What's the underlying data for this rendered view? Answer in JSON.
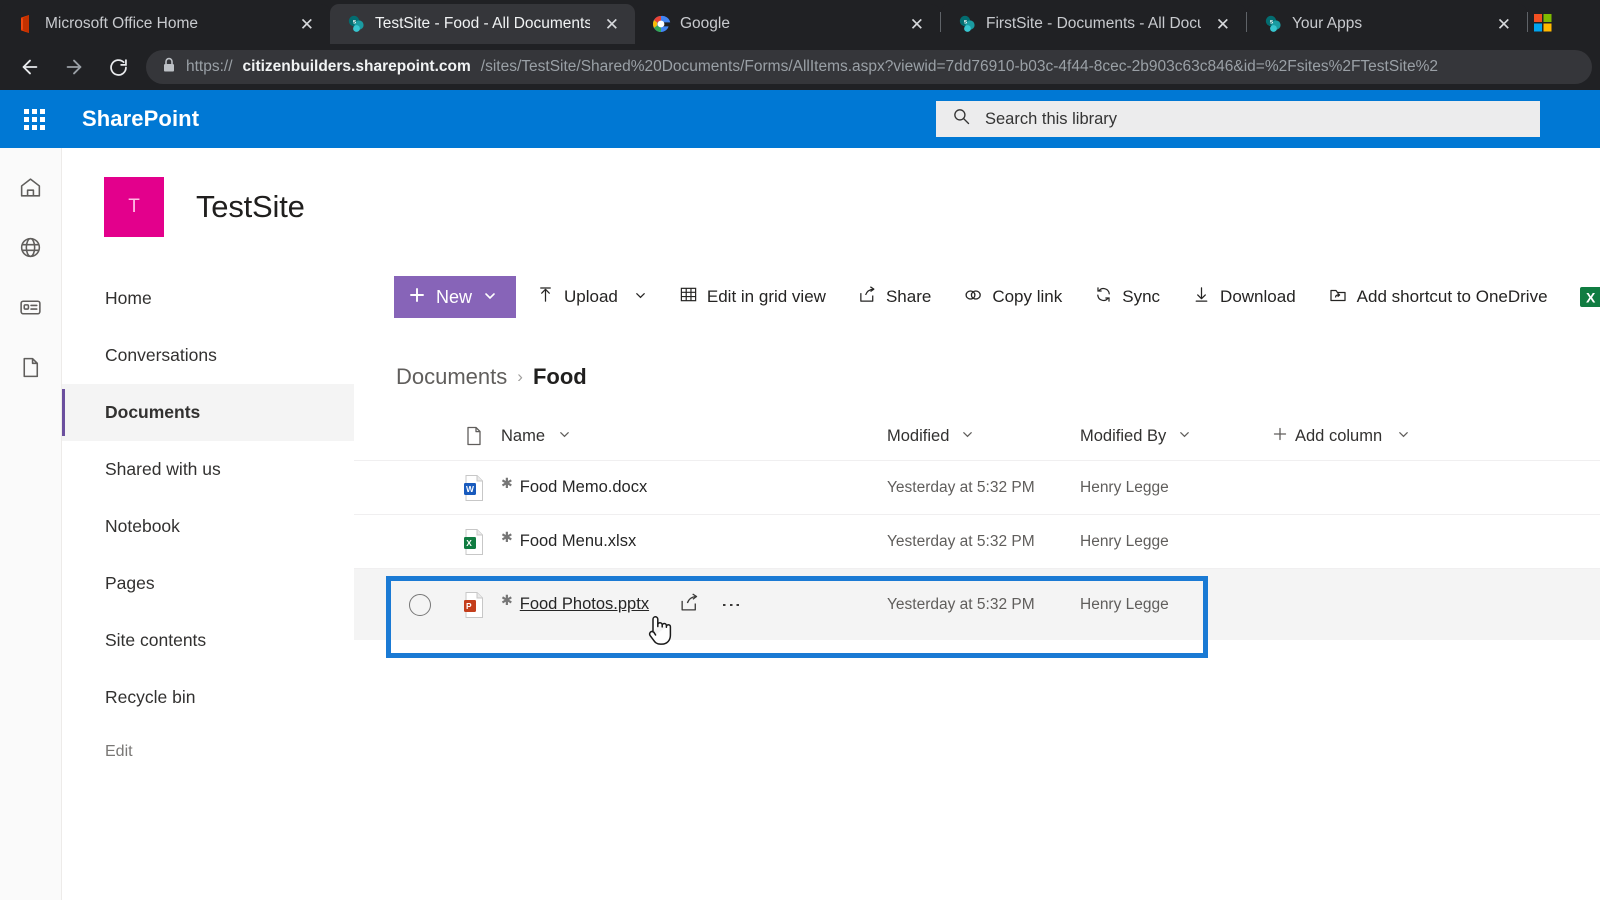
{
  "browser": {
    "tabs": [
      {
        "title": "Microsoft Office Home",
        "favicon": "office-icon",
        "close": "✕",
        "active": false
      },
      {
        "title": "TestSite - Food - All Documents",
        "favicon": "sharepoint-icon",
        "close": "✕",
        "active": true
      },
      {
        "title": "Google",
        "favicon": "google-icon",
        "close": "✕",
        "active": false
      },
      {
        "title": "FirstSite - Documents - All Docum",
        "favicon": "sharepoint-icon",
        "close": "✕",
        "active": false
      },
      {
        "title": "Your Apps",
        "favicon": "sharepoint-icon",
        "close": "✕",
        "active": false
      }
    ],
    "nav": {
      "back": "back-arrow-icon",
      "forward": "forward-arrow-icon",
      "reload": "reload-icon",
      "lock": "lock-icon"
    },
    "url": {
      "scheme": "https://",
      "host": "citizenbuilders.sharepoint.com",
      "path": "/sites/TestSite/Shared%20Documents/Forms/AllItems.aspx?viewid=7dd76910-b03c-4f44-8cec-2b903c63c846&id=%2Fsites%2FTestSite%2"
    }
  },
  "suitebar": {
    "waffle": "app-launcher-icon",
    "brand": "SharePoint",
    "search_placeholder": "Search this library",
    "search_icon": "search-icon",
    "color": "#0078d4"
  },
  "rail": {
    "items": [
      {
        "icon": "home-icon"
      },
      {
        "icon": "globe-icon"
      },
      {
        "icon": "news-icon"
      },
      {
        "icon": "document-icon"
      }
    ]
  },
  "site": {
    "logo_letter": "T",
    "logo_color": "#e3008c",
    "title": "TestSite"
  },
  "leftnav": {
    "items": [
      {
        "label": "Home",
        "selected": false
      },
      {
        "label": "Conversations",
        "selected": false
      },
      {
        "label": "Documents",
        "selected": true
      },
      {
        "label": "Shared with us",
        "selected": false
      },
      {
        "label": "Notebook",
        "selected": false
      },
      {
        "label": "Pages",
        "selected": false
      },
      {
        "label": "Site contents",
        "selected": false
      },
      {
        "label": "Recycle bin",
        "selected": false
      }
    ],
    "edit_label": "Edit",
    "accent": "#6b4f9e"
  },
  "commandbar": {
    "new_label": "New",
    "new_color": "#8764b8",
    "commands": [
      {
        "label": "Upload",
        "icon": "upload-icon",
        "has_chevron": true
      },
      {
        "label": "Edit in grid view",
        "icon": "grid-icon",
        "has_chevron": false
      },
      {
        "label": "Share",
        "icon": "share-icon",
        "has_chevron": false
      },
      {
        "label": "Copy link",
        "icon": "link-icon",
        "has_chevron": false
      },
      {
        "label": "Sync",
        "icon": "sync-icon",
        "has_chevron": false
      },
      {
        "label": "Download",
        "icon": "download-icon",
        "has_chevron": false
      },
      {
        "label": "Add shortcut to OneDrive",
        "icon": "onedrive-shortcut-icon",
        "has_chevron": false
      }
    ],
    "overflow_icon": "excel-export-icon"
  },
  "breadcrumb": {
    "root": "Documents",
    "separator": "›",
    "current": "Food"
  },
  "list": {
    "columns": {
      "type_icon": "file-type-icon",
      "name": "Name",
      "modified": "Modified",
      "modified_by": "Modified By",
      "add_column": "Add column"
    },
    "rows": [
      {
        "name": "Food Memo.docx",
        "file_type": "word",
        "modified": "Yesterday at 5:32 PM",
        "modified_by": "Henry Legge",
        "is_new": true,
        "highlighted": false,
        "hovered": false
      },
      {
        "name": "Food Menu.xlsx",
        "file_type": "excel",
        "modified": "Yesterday at 5:32 PM",
        "modified_by": "Henry Legge",
        "is_new": true,
        "highlighted": false,
        "hovered": false
      },
      {
        "name": "Food Photos.pptx",
        "file_type": "powerpoint",
        "modified": "Yesterday at 5:32 PM",
        "modified_by": "Henry Legge",
        "is_new": true,
        "highlighted": true,
        "hovered": true
      }
    ]
  },
  "highlight": {
    "color": "#1a7ad4",
    "target_row": "Food Photos.pptx"
  },
  "cursor": {
    "type": "pointer-hand-cursor"
  }
}
